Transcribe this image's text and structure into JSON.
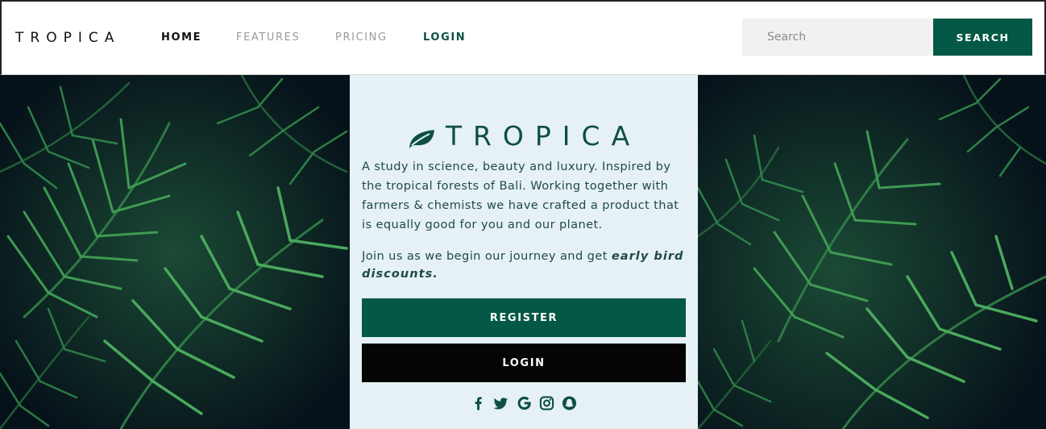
{
  "navbar": {
    "brand": "TROPICA",
    "links": [
      "HOME",
      "FEATURES",
      "PRICING",
      "LOGIN"
    ],
    "search": {
      "placeholder": "Search",
      "button_label": "SEARCH"
    }
  },
  "hero": {
    "logo_text": "TROPICA",
    "intro": "A study in science, beauty and luxury. Inspired by the tropical forests of Bali. Working together with farmers & chemists we have crafted a product that is equally good for you and our planet.",
    "join_prefix": "Join us as we begin our journey and get ",
    "join_emphasis": "early bird discounts.",
    "register_label": "REGISTER",
    "login_label": "LOGIN",
    "social_icons": [
      "facebook-icon",
      "twitter-icon",
      "google-icon",
      "instagram-icon",
      "snapchat-icon"
    ]
  },
  "colors": {
    "brand_green": "#045846",
    "dark_green_text": "#0d4f45",
    "panel_bg": "#e6f1f5",
    "login_button": "#050505"
  }
}
